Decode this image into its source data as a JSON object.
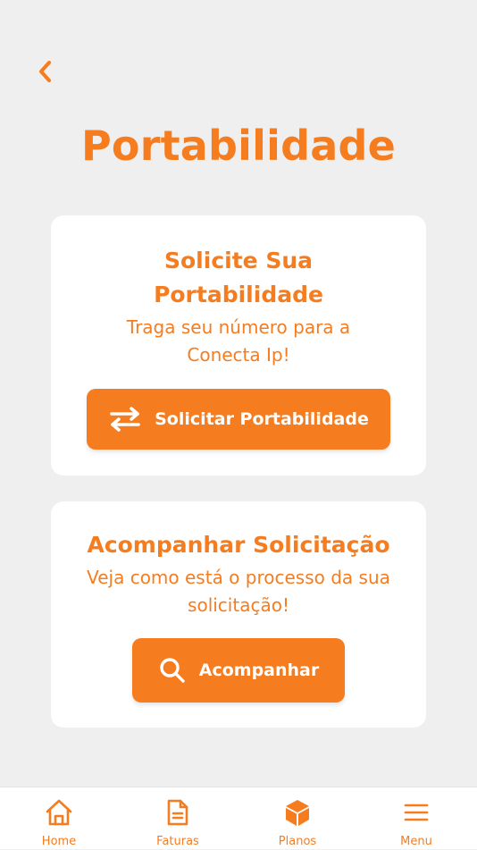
{
  "colors": {
    "accent": "#f57c1f",
    "background": "#efefef",
    "card": "#ffffff"
  },
  "header": {
    "back_icon": "chevron-left-icon",
    "title": "Portabilidade"
  },
  "cards": [
    {
      "title": "Solicite Sua Portabilidade",
      "subtitle": "Traga seu número para a Conecta Ip!",
      "button_label": "Solicitar Portabilidade",
      "button_icon": "swap-arrows-icon"
    },
    {
      "title": "Acompanhar Solicitação",
      "subtitle": "Veja como está o processo da sua solicitação!",
      "button_label": "Acompanhar",
      "button_icon": "search-icon"
    }
  ],
  "tabbar": {
    "items": [
      {
        "label": "Home",
        "icon": "home-icon"
      },
      {
        "label": "Faturas",
        "icon": "document-icon"
      },
      {
        "label": "Planos",
        "icon": "cube-icon"
      },
      {
        "label": "Menu",
        "icon": "menu-icon"
      }
    ]
  }
}
